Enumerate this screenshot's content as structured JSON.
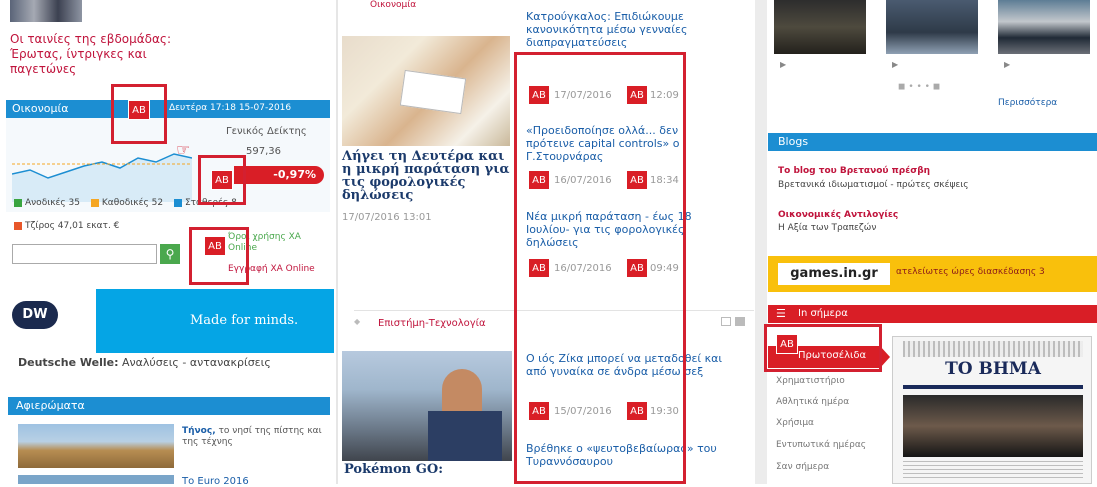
{
  "left": {
    "movies_text": "Οι ταινίες της εβδομάδας: Έρωτας, ίντριγκες και παγετώνες",
    "economy_head": "Οικονομία",
    "economy_date": "Δευτέρα 17:18 15-07-2016",
    "index_label": "Γενικός Δείκτης",
    "index_value": "597,36",
    "index_change": "-0,97%",
    "legend": [
      {
        "label": "Ανοδικές 35",
        "color": "#3aa540"
      },
      {
        "label": "Καθοδικές 52",
        "color": "#f5a623"
      },
      {
        "label": "Σταθερές 8",
        "color": "#1c8ed2"
      },
      {
        "label": "Τζίρος 47,01 εκατ. €",
        "color": "#e8572a"
      }
    ],
    "subs": [
      "Όροι χρήσης ΧΑ Online",
      "Εγγραφή ΧΑ Online"
    ],
    "dw_logo": "DW",
    "dw_slogan": "Made for minds.",
    "dw_caption_bold": "Deutsche Welle:",
    "dw_caption": "Αναλύσεις - αντανακρίσεις",
    "afieromata": "Αφιερώματα",
    "tinos_bold": "Τήνος,",
    "tinos_rest": "το νησί της πίστης και της τέχνης",
    "euro_text": "Το Euro 2016"
  },
  "middle": {
    "top_label": "Οικονομία",
    "feature_title": "Λήγει τη Δευτέρα και η μικρή παράταση για τις φορολογικές δηλώσεις",
    "feature_date": "17/07/2016 13:01",
    "news": [
      {
        "title": "Κατρούγκαλος: Επιδιώκουμε κανονικότητα μέσω γενναίες διαπραγματεύσεις",
        "date": "17/07/2016",
        "time": "12:09"
      },
      {
        "title": "«Προειδοποίησε ολλά... δεν πρότεινε capital controls» ο Γ.Στουρνάρας",
        "date": "16/07/2016",
        "time": "18:34"
      },
      {
        "title": "Νέα μικρή παράταση - έως 18 Ιουλίου- για τις φορολογικές δηλώσεις",
        "date": "16/07/2016",
        "time": "09:49"
      }
    ],
    "science_label": "Επιστήμη-Τεχνολογία",
    "pokemon": "Pokémon GO:",
    "science_news": [
      {
        "title": "Ο ιός Ζίκα μπορεί να μεταδοθεί και από γυναίκα σε άνδρα μέσω σεξ",
        "date": "15/07/2016",
        "time": "19:30"
      },
      {
        "title": "Βρέθηκε ο «ψευτοβεβαίωρας» του Τυραννόσαυρου",
        "date": "",
        "time": ""
      }
    ]
  },
  "right": {
    "more": "Περισσότερα",
    "blogs_head": "Blogs",
    "blog1_title": "Το blog του Βρετανού πρέσβη",
    "blog1_sub": "Βρετανικά ιδιωματισμοί - πρώτες σκέψεις",
    "blog2_title": "Οικονομικές Αντιλογίες",
    "blog2_sub": "Η Αξία των Τραπεζών",
    "games": "games.in.gr",
    "games_tag": "ατελείωτες ώρες διασκέδασης 3",
    "today_head": "In σήμερα",
    "menu": [
      "Πρωτοσέλιδα",
      "Χρηματιστήριο",
      "Αθλητικά ημέρα",
      "Χρήσιμα",
      "Εντυπωτικά ημέρας",
      "Σαν σήμερα"
    ],
    "newspaper": "ΤΟ ΒΗΜΑ"
  },
  "marker_label": "AB"
}
